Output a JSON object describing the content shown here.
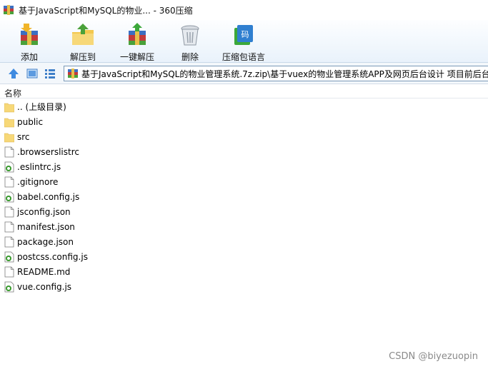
{
  "window": {
    "title": "基于JavaScript和MySQL的物业... - 360压缩"
  },
  "toolbar": {
    "buttons": [
      {
        "label": "添加",
        "icon": "add-archive-icon"
      },
      {
        "label": "解压到",
        "icon": "extract-to-icon"
      },
      {
        "label": "一键解压",
        "icon": "one-click-extract-icon"
      },
      {
        "label": "删除",
        "icon": "delete-icon"
      },
      {
        "label": "压缩包语言",
        "icon": "archive-language-icon"
      }
    ]
  },
  "address": {
    "path": "基于JavaScript和MySQL的物业管理系统.7z.zip\\基于vuex的物业管理系统APP及网页后台设计 项目前后台源"
  },
  "columns": {
    "name": "名称"
  },
  "files": [
    {
      "name": ".. (上级目录)",
      "type": "folder"
    },
    {
      "name": "public",
      "type": "folder"
    },
    {
      "name": "src",
      "type": "folder"
    },
    {
      "name": ".browserslistrc",
      "type": "file"
    },
    {
      "name": ".eslintrc.js",
      "type": "js"
    },
    {
      "name": ".gitignore",
      "type": "file"
    },
    {
      "name": "babel.config.js",
      "type": "js"
    },
    {
      "name": "jsconfig.json",
      "type": "file"
    },
    {
      "name": "manifest.json",
      "type": "file"
    },
    {
      "name": "package.json",
      "type": "file"
    },
    {
      "name": "postcss.config.js",
      "type": "js"
    },
    {
      "name": "README.md",
      "type": "file"
    },
    {
      "name": "vue.config.js",
      "type": "js"
    }
  ],
  "watermark": "CSDN @biyezuopin",
  "colors": {
    "folder": "#f7d878",
    "js_badge": "#3a9a2e",
    "toolbar_bg": "#e9f2fb"
  }
}
